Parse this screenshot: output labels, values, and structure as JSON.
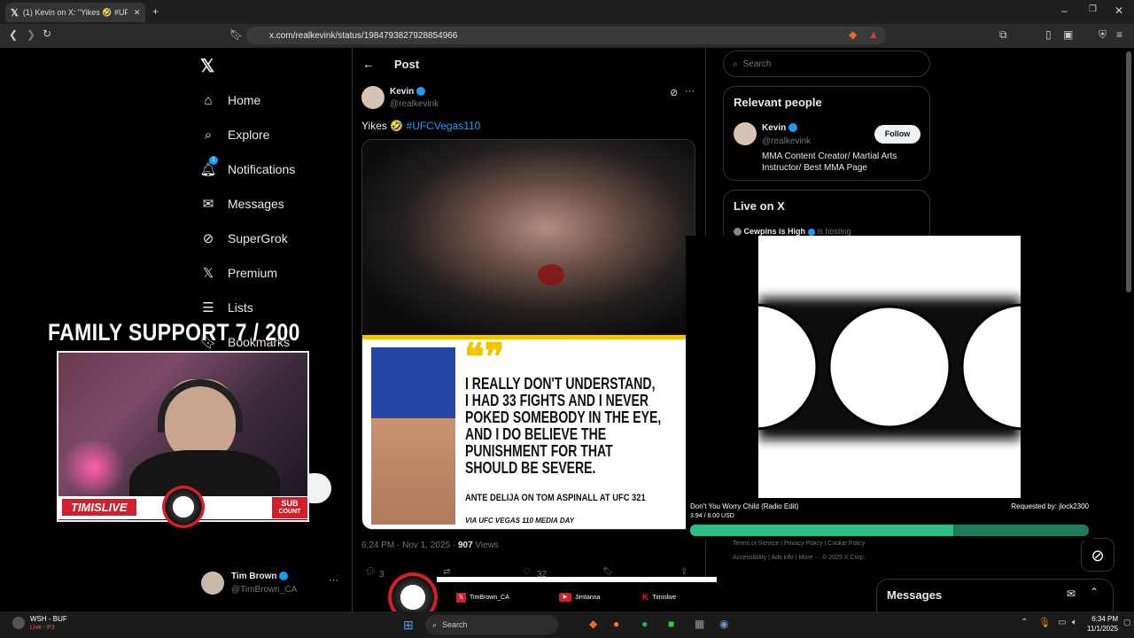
{
  "browser": {
    "tab_title": "(1) Kevin on X: \"Yikes 🤣 #UFCV",
    "url": "x.com/realkevink/status/1984793827928854966"
  },
  "sidebar": {
    "items": [
      {
        "label": "Home",
        "icon": "home-icon"
      },
      {
        "label": "Explore",
        "icon": "search-icon"
      },
      {
        "label": "Notifications",
        "icon": "bell-icon",
        "badge": "1"
      },
      {
        "label": "Messages",
        "icon": "mail-icon"
      },
      {
        "label": "SuperGrok",
        "icon": "grok-icon"
      },
      {
        "label": "Premium",
        "icon": "x-logo-icon"
      },
      {
        "label": "Lists",
        "icon": "list-icon"
      },
      {
        "label": "Bookmarks",
        "icon": "bookmark-icon"
      }
    ],
    "account": {
      "name": "Tim Brown",
      "handle": "@TimBrown_CA"
    }
  },
  "post": {
    "header": "Post",
    "author_name": "Kevin",
    "author_handle": "@realkevink",
    "text": "Yikes 🤣 ",
    "hashtag": "#UFCVegas110",
    "quote_lines": [
      "I REALLY DON'T UNDERSTAND,",
      "I HAD 33 FIGHTS AND I NEVER",
      "POKED SOMEBODY IN THE EYE,",
      "AND I DO BELIEVE THE",
      "PUNISHMENT FOR THAT",
      "SHOULD BE SEVERE."
    ],
    "attribution": "ANTE DELIJA ON TOM ASPINALL AT UFC 321",
    "via": "VIA UFC VEGAS 110 MEDIA DAY",
    "timestamp": "6:24 PM · Nov 1, 2025 · ",
    "views_count": "907",
    "views_label": " Views",
    "reply_count": "3",
    "like_count": "32"
  },
  "right": {
    "search_placeholder": "Search",
    "relevant_title": "Relevant people",
    "person_name": "Kevin",
    "person_handle": "@realkevink",
    "follow_label": "Follow",
    "person_bio": "MMA Content Creator/ Martial Arts Instructor/ Best MMA Page",
    "live_title": "Live on X",
    "live_host": "Cewpins is High",
    "live_status": " is hosting",
    "footer_links": [
      "Terms of Service",
      "Privacy Policy",
      "Cookie Policy",
      "Accessibility",
      "Ads info",
      "More ···",
      "© 2025 X Corp."
    ],
    "messages_label": "Messages"
  },
  "overlay": {
    "family_support": "FAMILY SUPPORT  7 / 200",
    "brand": "TIMISLIVE",
    "sub_top": "SUB",
    "sub_bottom": "COUNT",
    "song_title": "Don't You Worry Child (Radio Edit)",
    "song_requested": "Requested by: jlock2300",
    "song_progress_text": "3.94 / 6.00 USD",
    "song_progress": 0.66,
    "socials": [
      "TimBrown_CA",
      "Jimtanna",
      "Timislive"
    ]
  },
  "taskbar": {
    "game_title": "WSH - BUF",
    "game_status": "Live - P3",
    "search": "Search",
    "time": "6:34 PM",
    "date": "11/1/2025"
  },
  "colors": {
    "accent": "#1d9bf0",
    "progress": "#2ebd85",
    "brand_red": "#d21f2b"
  }
}
